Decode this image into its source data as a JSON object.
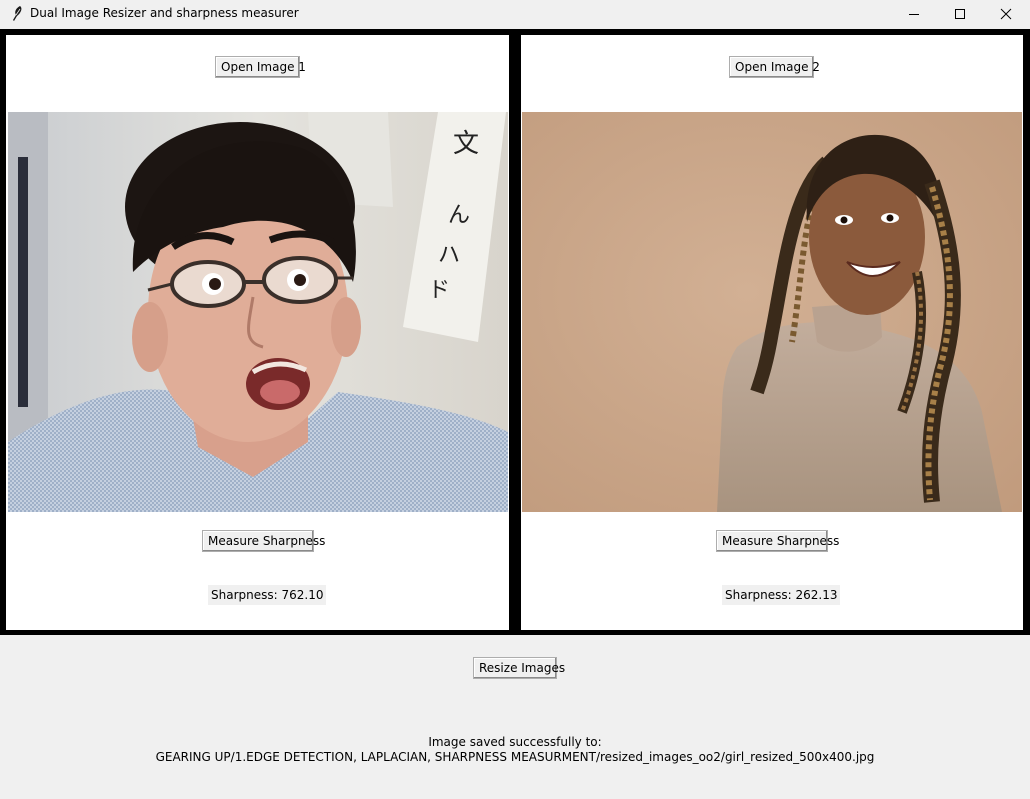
{
  "window": {
    "title": "Dual Image Resizer and sharpness measurer"
  },
  "panel1": {
    "open_label": "Open Image 1",
    "measure_label": "Measure Sharpness",
    "sharpness_text": "Sharpness: 762.10"
  },
  "panel2": {
    "open_label": "Open Image 2",
    "measure_label": "Measure Sharpness",
    "sharpness_text": "Sharpness: 262.13"
  },
  "bottom": {
    "resize_label": "Resize Images",
    "status_line1": "Image saved successfully to:",
    "status_line2": "GEARING UP/1.EDGE DETECTION, LAPLACIAN, SHARPNESS MEASURMENT/resized_images_oo2/girl_resized_500x400.jpg"
  },
  "colors": {
    "window_bg": "#f0f0f0",
    "panel_border": "#000000",
    "panel_bg": "#ffffff"
  },
  "icons": [
    "feather-icon",
    "minimize-icon",
    "maximize-icon",
    "close-icon"
  ]
}
